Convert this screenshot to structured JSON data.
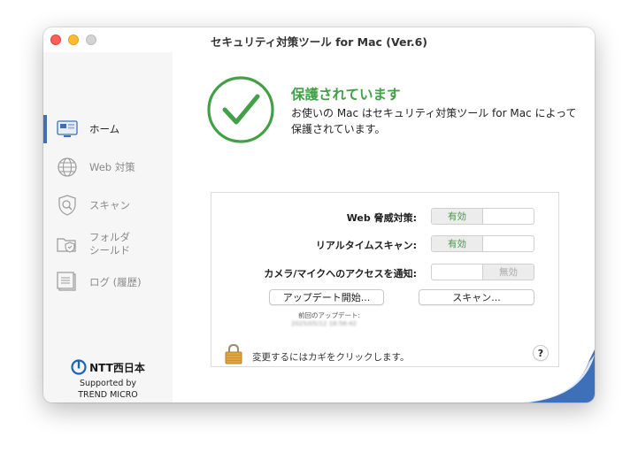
{
  "window": {
    "title": "セキュリティ対策ツール for Mac (Ver.6)"
  },
  "sidebar": {
    "items": [
      {
        "label": "ホーム",
        "icon": "home-monitor-icon",
        "active": true
      },
      {
        "label": "Web 対策",
        "icon": "globe-icon",
        "active": false
      },
      {
        "label": "スキャン",
        "icon": "scan-shield-icon",
        "active": false
      },
      {
        "label": "フォルダ\nシールド",
        "icon": "folder-shield-icon",
        "active": false
      },
      {
        "label": "ログ (履歴)",
        "icon": "log-icon",
        "active": false
      }
    ],
    "brand": {
      "logo_text": "NTT西日本",
      "supported_by": "Supported by",
      "vendor": "TREND MICRO"
    }
  },
  "status": {
    "title": "保護されています",
    "description": "お使いの Mac はセキュリティ対策ツール for Mac によって保護されています。",
    "icon": "check-circle-icon",
    "color": "#43a047"
  },
  "settings": {
    "rows": [
      {
        "label": "Web 脅威対策:",
        "on_label": "有効",
        "off_label": "",
        "state": "on"
      },
      {
        "label": "リアルタイムスキャン:",
        "on_label": "有効",
        "off_label": "",
        "state": "on"
      },
      {
        "label": "カメラ/マイクへのアクセスを通知:",
        "on_label": "",
        "off_label": "無効",
        "state": "off"
      }
    ],
    "update_button": "アップデート開始...",
    "scan_button": "スキャン...",
    "last_update_label": "前回のアップデート:",
    "last_update_value": "2025/05/12 18:58:42"
  },
  "footer": {
    "lock_text": "変更するにはカギをクリックします。",
    "help": "?"
  },
  "colors": {
    "accent": "#3d70b8",
    "protected": "#43a047",
    "lock": "#d9a03a"
  }
}
